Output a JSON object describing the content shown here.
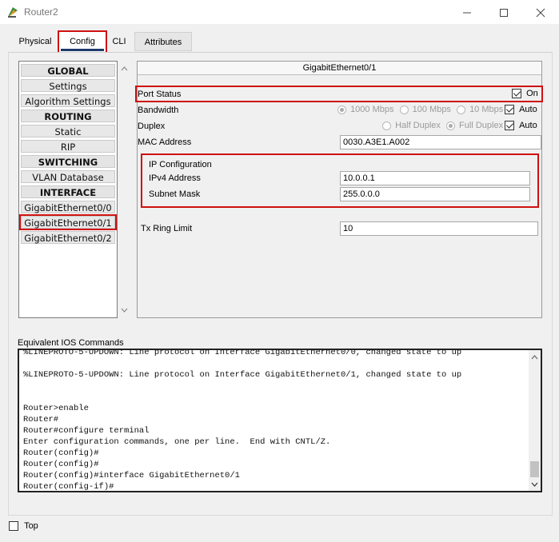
{
  "window": {
    "title": "Router2"
  },
  "tabs": [
    {
      "label": "Physical"
    },
    {
      "label": "Config"
    },
    {
      "label": "CLI"
    },
    {
      "label": "Attributes"
    }
  ],
  "sidebar": {
    "items": [
      {
        "label": "GLOBAL",
        "header": true
      },
      {
        "label": "Settings"
      },
      {
        "label": "Algorithm Settings"
      },
      {
        "label": "ROUTING",
        "header": true
      },
      {
        "label": "Static"
      },
      {
        "label": "RIP"
      },
      {
        "label": "SWITCHING",
        "header": true
      },
      {
        "label": "VLAN Database"
      },
      {
        "label": "INTERFACE",
        "header": true
      },
      {
        "label": "GigabitEthernet0/0"
      },
      {
        "label": "GigabitEthernet0/1",
        "selected": true
      },
      {
        "label": "GigabitEthernet0/2"
      }
    ]
  },
  "panel": {
    "title": "GigabitEthernet0/1",
    "port_status": {
      "label": "Port Status",
      "on_label": "On",
      "checked": true
    },
    "bandwidth": {
      "label": "Bandwidth",
      "options": [
        "1000 Mbps",
        "100 Mbps",
        "10 Mbps"
      ],
      "auto_label": "Auto"
    },
    "duplex": {
      "label": "Duplex",
      "options": [
        "Half Duplex",
        "Full Duplex"
      ],
      "auto_label": "Auto"
    },
    "mac": {
      "label": "MAC Address",
      "value": "0030.A3E1.A002"
    },
    "ip_config": {
      "heading": "IP Configuration",
      "ipv4_label": "IPv4 Address",
      "ipv4_value": "10.0.0.1",
      "mask_label": "Subnet Mask",
      "mask_value": "255.0.0.0"
    },
    "tx_ring": {
      "label": "Tx Ring Limit",
      "value": "10"
    }
  },
  "console": {
    "label": "Equivalent IOS Commands",
    "lines": [
      "%LINEPROTO-5-UPDOWN: Line protocol on Interface GigabitEthernet0/0, changed state to up",
      "",
      "%LINEPROTO-5-UPDOWN: Line protocol on Interface GigabitEthernet0/1, changed state to up",
      "",
      "",
      "Router>enable",
      "Router#",
      "Router#configure terminal",
      "Enter configuration commands, one per line.  End with CNTL/Z.",
      "Router(config)#",
      "Router(config)#",
      "Router(config)#interface GigabitEthernet0/1",
      "Router(config-if)#"
    ]
  },
  "footer": {
    "top_label": "Top"
  }
}
